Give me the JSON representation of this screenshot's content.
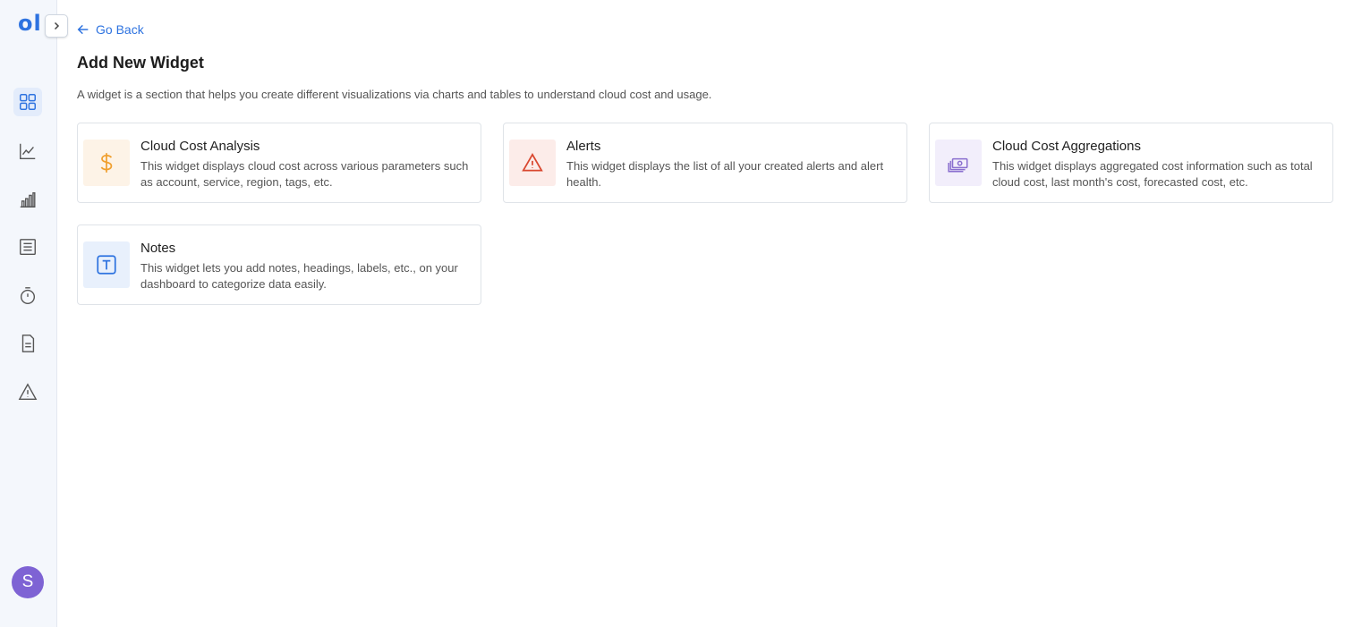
{
  "sidebar": {
    "logo": "ol",
    "avatar_initial": "S",
    "items": [
      {
        "name": "dashboard-icon"
      },
      {
        "name": "line-chart-icon"
      },
      {
        "name": "bar-chart-icon"
      },
      {
        "name": "list-icon"
      },
      {
        "name": "stopwatch-icon"
      },
      {
        "name": "document-icon"
      },
      {
        "name": "warning-icon"
      }
    ]
  },
  "header": {
    "back_label": "Go Back",
    "title": "Add New Widget",
    "description": "A widget is a section that helps you create different visualizations via charts and tables to understand cloud cost and usage."
  },
  "widgets": [
    {
      "title": "Cloud Cost Analysis",
      "description": "This widget displays cloud cost across various parameters such as account, service, region, tags, etc.",
      "icon": "dollar-icon",
      "color": "#f0a030",
      "bg": "#fdf3e7"
    },
    {
      "title": "Alerts",
      "description": "This widget displays the list of all your created alerts and alert health.",
      "icon": "alert-icon",
      "color": "#d9472f",
      "bg": "#fcece9"
    },
    {
      "title": "Cloud Cost Aggregations",
      "description": "This widget displays aggregated cost information such as total cloud cost, last month's cost, forecasted cost, etc.",
      "icon": "cash-stack-icon",
      "color": "#8a6fcf",
      "bg": "#f2eefb"
    },
    {
      "title": "Notes",
      "description": "This widget lets you add notes, headings, labels, etc., on your dashboard to categorize data easily.",
      "icon": "text-icon",
      "color": "#2e73e0",
      "bg": "#e8f0fc"
    }
  ]
}
